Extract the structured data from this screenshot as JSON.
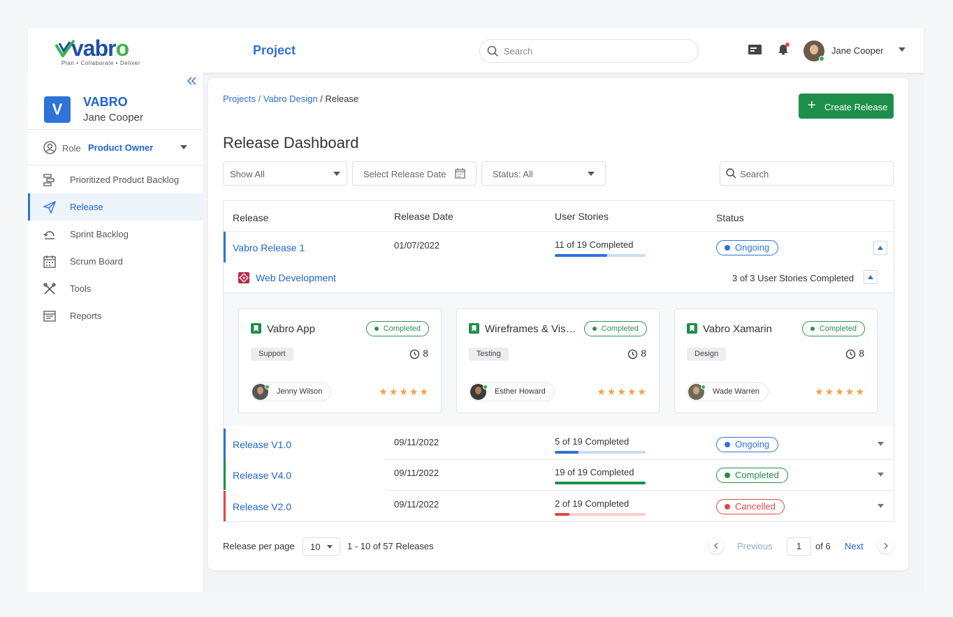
{
  "app": {
    "logo_text": "vabro",
    "tagline": "Plan • Collaborate • Deliver",
    "section_title": "Project"
  },
  "topbar": {
    "search_placeholder": "Search",
    "user_name": "Jane Cooper"
  },
  "sidebar": {
    "org_initial": "V",
    "org_name": "VABRO",
    "org_user": "Jane Cooper",
    "role_label": "Role",
    "role_value": "Product Owner",
    "items": [
      {
        "label": "Prioritized Product Backlog",
        "icon": "backlog-icon"
      },
      {
        "label": "Release",
        "icon": "paper-plane-icon",
        "active": true
      },
      {
        "label": "Sprint Backlog",
        "icon": "sprint-icon"
      },
      {
        "label": "Scrum Board",
        "icon": "calendar-icon"
      },
      {
        "label": "Tools",
        "icon": "tools-icon"
      },
      {
        "label": "Reports",
        "icon": "reports-icon"
      }
    ]
  },
  "main": {
    "breadcrumb": {
      "projects": "Projects",
      "sep1": " / ",
      "project": "Vabro Design",
      "sep2": " / ",
      "current": "Release"
    },
    "create_button": "Create Release",
    "title": "Release Dashboard",
    "filters": {
      "show": "Show All",
      "date": "Select Release Date",
      "status": "Status: All",
      "search_placeholder": "Search"
    },
    "table": {
      "headers": [
        "Release",
        "Release Date",
        "User Stories",
        "Status"
      ],
      "rows": [
        {
          "name": "Vabro Release 1",
          "date": "01/07/2022",
          "stories": "11 of 19 Completed",
          "progress": 0.58,
          "status": "Ongoing",
          "color": "#2d73d8",
          "track": "#c9dcf5"
        },
        {
          "name": "Release V1.0",
          "date": "09/11/2022",
          "stories": "5 of 19 Completed",
          "progress": 0.26,
          "status": "Ongoing",
          "color": "#2d73d8",
          "track": "#c9dcf5"
        },
        {
          "name": "Release V4.0",
          "date": "09/11/2022",
          "stories": "19 of 19 Completed",
          "progress": 1.0,
          "status": "Completed",
          "color": "#1e8f4a",
          "track": "#c9ead5"
        },
        {
          "name": "Release V2.0",
          "date": "09/11/2022",
          "stories": "2 of 19 Completed",
          "progress": 0.16,
          "status": "Cancelled",
          "color": "#e04848",
          "track": "#f8cfcf"
        }
      ]
    },
    "sub": {
      "name": "Web Development",
      "count": "3 of 3 User Stories Completed"
    },
    "cards": [
      {
        "title": "Vabro App",
        "status": "Completed",
        "tag": "Support",
        "points": "8",
        "assignee": "Jenny Wilson",
        "stars": "★★★★★"
      },
      {
        "title": "Wireframes & Visual Design",
        "status": "Completed",
        "tag": "Testing",
        "points": "8",
        "assignee": "Esther Howard",
        "stars": "★★★★★"
      },
      {
        "title": "Vabro Xamarin",
        "status": "Completed",
        "tag": "Design",
        "points": "8",
        "assignee": "Wade Warren",
        "stars": "★★★★★"
      }
    ],
    "footer": {
      "per_page_label": "Release per page",
      "per_page_value": "10",
      "range": "1 - 10 of 57 Releases",
      "prev": "Previous",
      "page": "1",
      "of": "of 6",
      "next": "Next"
    }
  }
}
